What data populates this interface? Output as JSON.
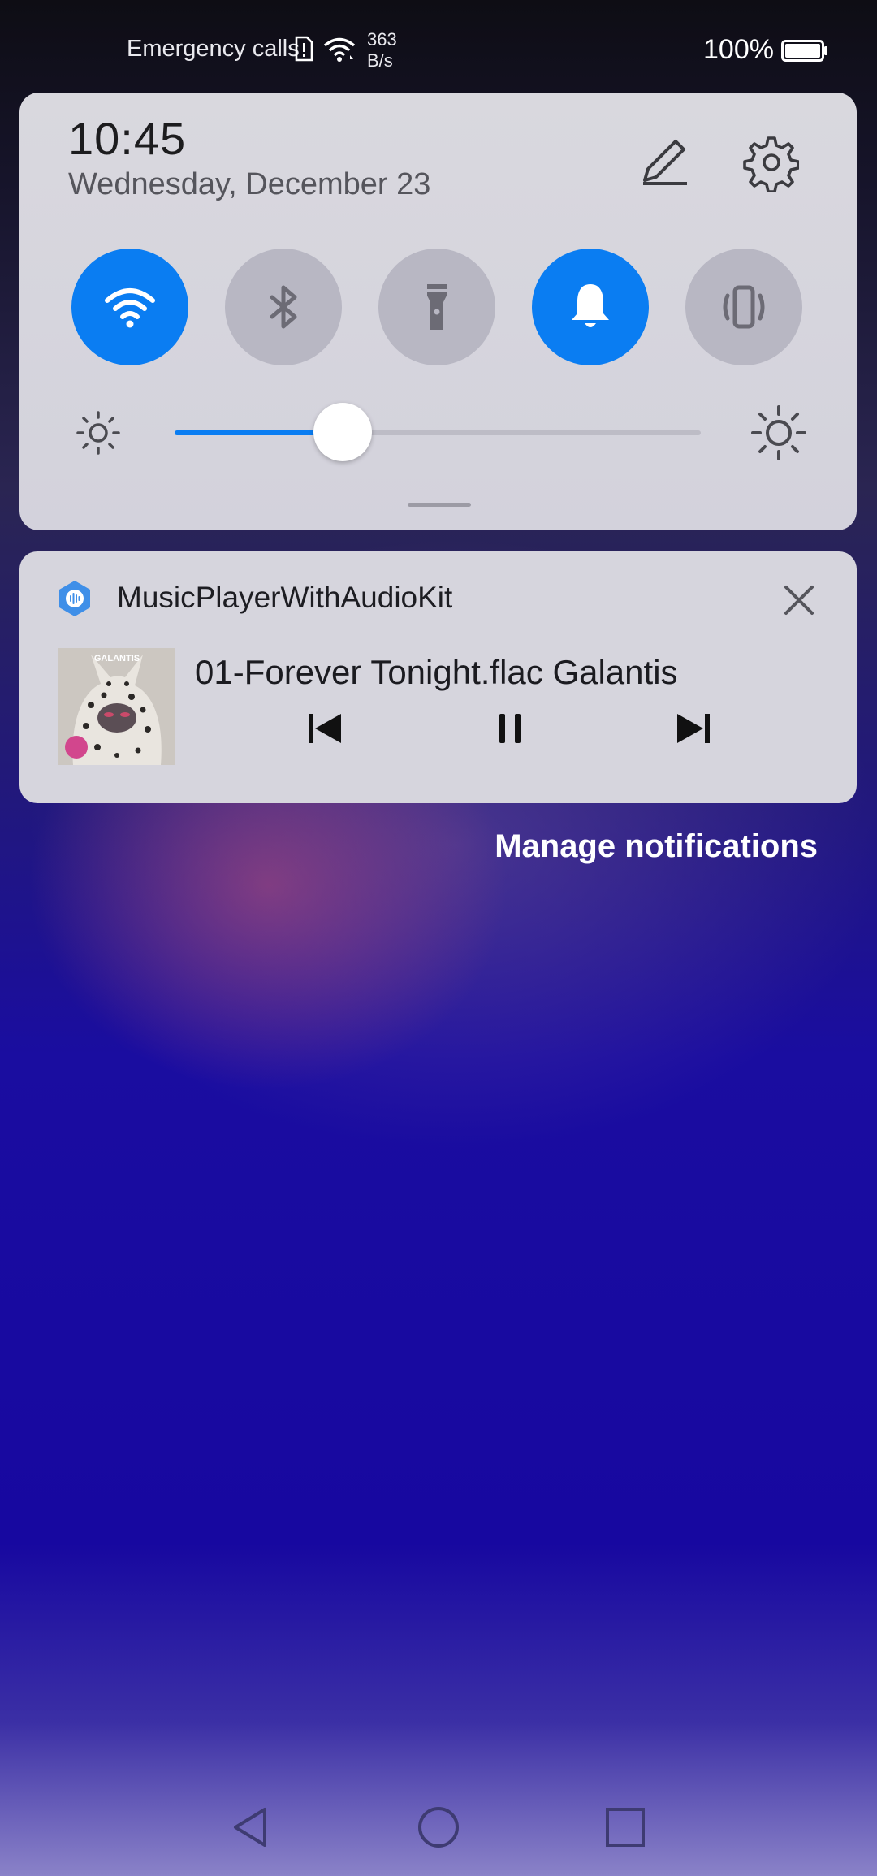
{
  "status_bar": {
    "carrier_text": "Emergency calls",
    "net_speed_value": "363",
    "net_speed_unit": "B/s",
    "battery_percent": "100%",
    "icons": [
      "sim-alert-icon",
      "wifi-icon",
      "battery-icon"
    ]
  },
  "quick_settings": {
    "time": "10:45",
    "date": "Wednesday, December 23",
    "tiles": [
      {
        "name": "wifi",
        "icon": "wifi-icon",
        "active": true
      },
      {
        "name": "bluetooth",
        "icon": "bluetooth-icon",
        "active": false
      },
      {
        "name": "flashlight",
        "icon": "flashlight-icon",
        "active": false
      },
      {
        "name": "sound",
        "icon": "bell-icon",
        "active": true
      },
      {
        "name": "vibrate",
        "icon": "vibrate-icon",
        "active": false
      }
    ],
    "brightness_level": 0.32,
    "accent_color": "#0a7df2"
  },
  "notification": {
    "app_name": "MusicPlayerWithAudioKit",
    "track_title": "01-Forever Tonight.flac Galantis",
    "album_art_text": "GALANTIS",
    "controls": [
      "previous-icon",
      "pause-icon",
      "next-icon"
    ]
  },
  "manage_notifications_label": "Manage notifications",
  "nav_bar": [
    "back-icon",
    "home-icon",
    "recents-icon"
  ]
}
